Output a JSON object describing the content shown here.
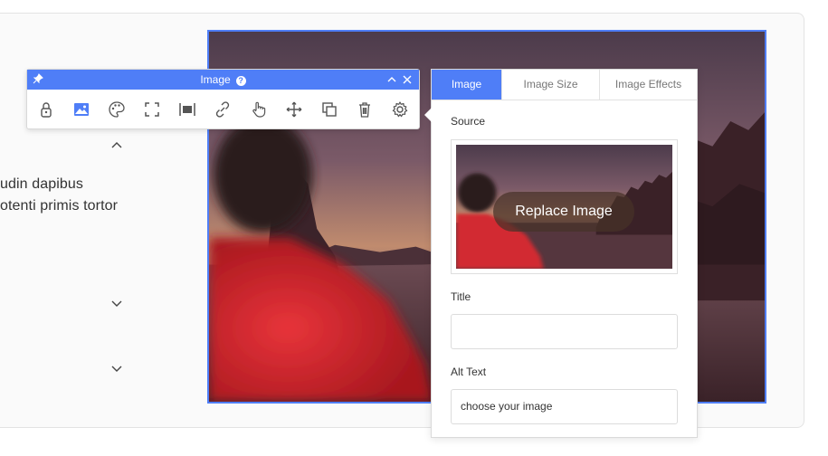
{
  "background_text": {
    "line1": "udin dapibus",
    "line2": "otenti primis tortor"
  },
  "toolbar": {
    "title": "Image",
    "help": "?",
    "accent": "#4f7ef7",
    "icons": [
      "pin-icon",
      "help-icon",
      "collapse-icon",
      "close-icon",
      "lock-icon",
      "image-icon",
      "palette-icon",
      "fullscreen-icon",
      "align-icon",
      "link-icon",
      "hand-pointer-icon",
      "move-icon",
      "duplicate-icon",
      "trash-icon",
      "gear-icon"
    ]
  },
  "panel": {
    "tabs": [
      "Image",
      "Image Size",
      "Image Effects"
    ],
    "active_tab": "Image",
    "source_label": "Source",
    "replace_label": "Replace Image",
    "title_label": "Title",
    "title_value": "",
    "alt_label": "Alt Text",
    "alt_value": "choose your image"
  }
}
